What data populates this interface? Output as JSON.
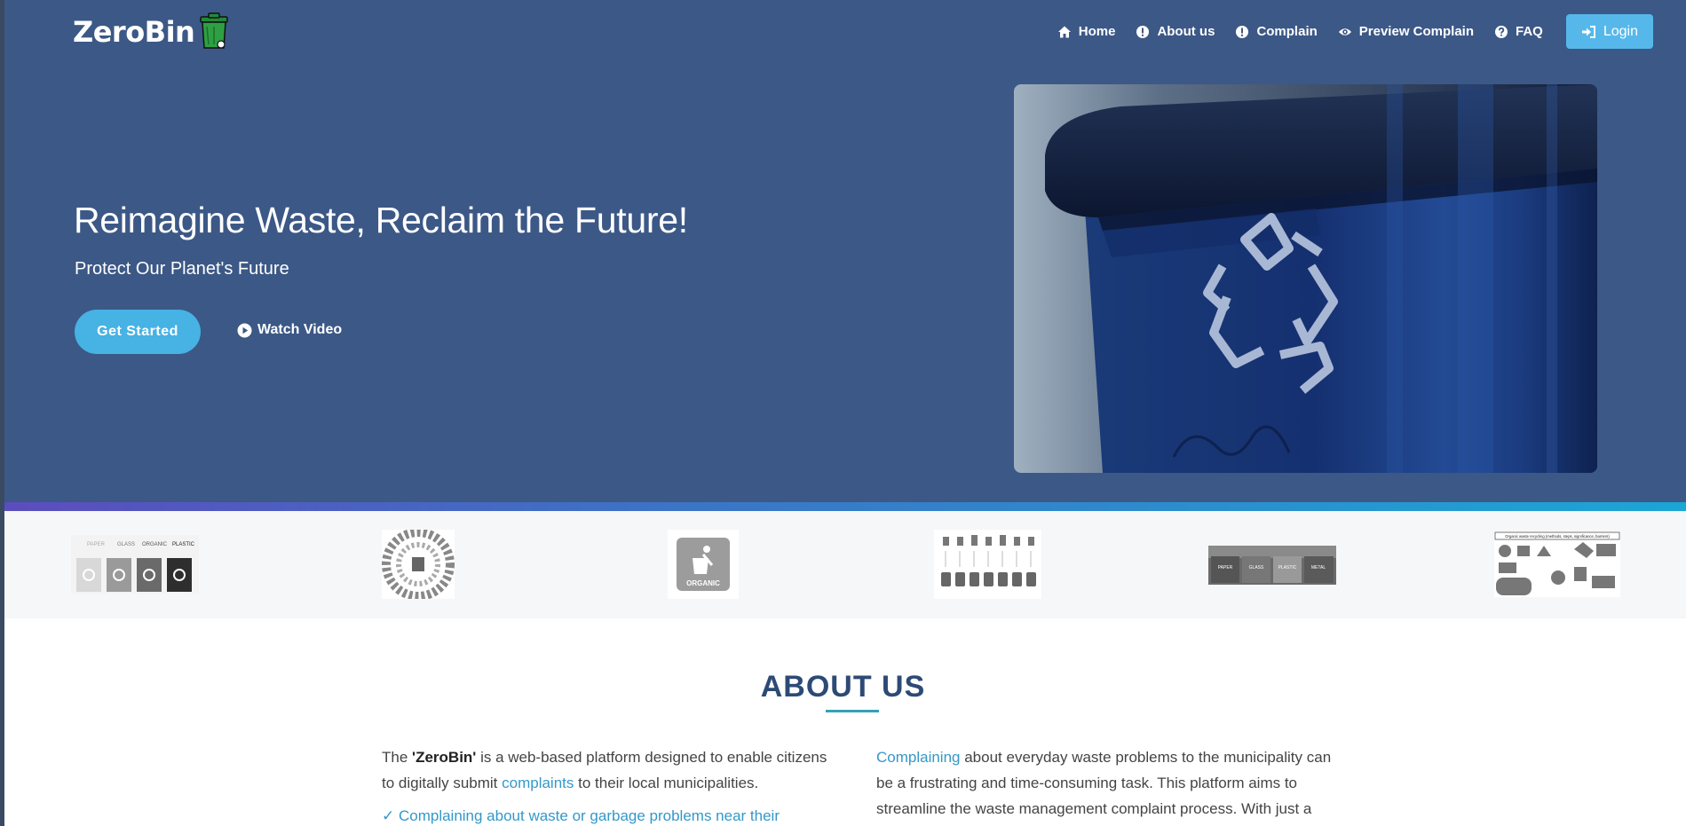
{
  "brand": {
    "name": "ZeroBin",
    "logo_icon": "green-trash-bin-icon"
  },
  "nav": {
    "items": [
      {
        "label": "Home",
        "icon": "home-icon"
      },
      {
        "label": "About us",
        "icon": "info-circle-icon"
      },
      {
        "label": "Complain",
        "icon": "info-circle-icon"
      },
      {
        "label": "Preview Complain",
        "icon": "eye-icon"
      },
      {
        "label": "FAQ",
        "icon": "question-circle-icon"
      }
    ],
    "login_label": "Login"
  },
  "hero": {
    "title": "Reimagine Waste, Reclaim the Future!",
    "subtitle": "Protect Our Planet's Future",
    "cta_label": "Get Started",
    "video_label": "Watch Video"
  },
  "clients": {
    "logos": [
      {
        "name": "recycling-bins-logo",
        "labels": [
          "PAPER",
          "GLASS",
          "ORGANIC",
          "PLASTIC"
        ]
      },
      {
        "name": "circular-waste-icons-logo"
      },
      {
        "name": "organic-bin-logo",
        "label": "ORGANIC"
      },
      {
        "name": "waste-sorting-chart-logo"
      },
      {
        "name": "sorting-bins-photo-logo",
        "labels": [
          "PAPER",
          "GLASS",
          "PLASTIC",
          "METAL"
        ]
      },
      {
        "name": "organic-recycling-diagram-logo",
        "label": "Organic waste recycling (methods, steps, significance, barriers)"
      }
    ]
  },
  "about": {
    "title": "ABOUT US",
    "left": {
      "p1_start": "The ",
      "p1_brand": "'ZeroBin'",
      "p1_mid": " is a web-based platform designed to enable citizens to digitally submit ",
      "p1_link": "complaints",
      "p1_end": " to their local municipalities.",
      "check1": "✓ Complaining about waste or garbage problems near their"
    },
    "right": {
      "p_link": "Complaining",
      "p_text": " about everyday waste problems to the municipality can be a frustrating and time-consuming task. This platform aims to streamline the waste management complaint process. With just a"
    }
  },
  "colors": {
    "hero_bg": "#3c5886",
    "accent": "#47b2e4",
    "login_bg": "#56b8ea",
    "heading": "#2d4a75",
    "link": "#3498c9"
  }
}
